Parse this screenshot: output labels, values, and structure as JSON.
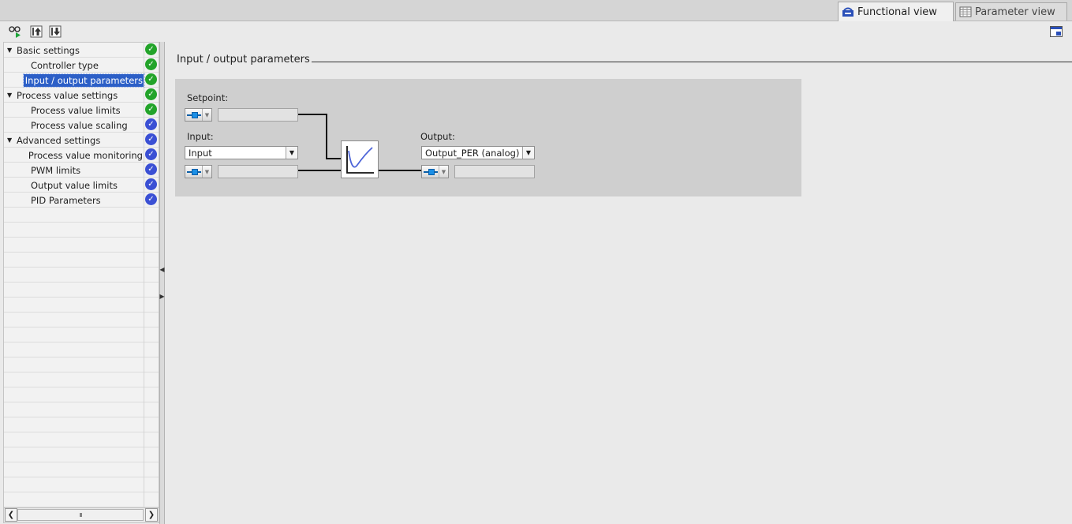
{
  "tabs": {
    "functional_view": "Functional view",
    "parameter_view": "Parameter view",
    "active": "Functional view"
  },
  "toolbar": {
    "icons": [
      "show-hide-icon",
      "move-up-icon",
      "move-down-icon"
    ]
  },
  "tree": {
    "items": [
      {
        "label": "Basic settings",
        "level": 0,
        "expanded": true,
        "status": "ok"
      },
      {
        "label": "Controller type",
        "level": 1,
        "status": "ok"
      },
      {
        "label": "Input / output parameters",
        "level": 1,
        "status": "ok",
        "selected": true
      },
      {
        "label": "Process value settings",
        "level": 0,
        "expanded": true,
        "status": "ok"
      },
      {
        "label": "Process value limits",
        "level": 1,
        "status": "ok"
      },
      {
        "label": "Process value scaling",
        "level": 1,
        "status": "default"
      },
      {
        "label": "Advanced settings",
        "level": 0,
        "expanded": true,
        "status": "default"
      },
      {
        "label": "Process value monitoring",
        "level": 1,
        "status": "default"
      },
      {
        "label": "PWM limits",
        "level": 1,
        "status": "default"
      },
      {
        "label": "Output value limits",
        "level": 1,
        "status": "default"
      },
      {
        "label": "PID Parameters",
        "level": 1,
        "status": "default"
      }
    ]
  },
  "scrollbar": {
    "thumb_grip": "III"
  },
  "section": {
    "title": "Input / output parameters"
  },
  "diagram": {
    "setpoint_label": "Setpoint:",
    "setpoint_value": "",
    "input_label": "Input:",
    "input_select": "Input",
    "input_value": "",
    "output_label": "Output:",
    "output_select": "Output_PER (analog)",
    "output_value": ""
  },
  "colors": {
    "status_ok": "#23a42a",
    "status_default": "#3b50d4",
    "selection": "#2c5fc7"
  }
}
